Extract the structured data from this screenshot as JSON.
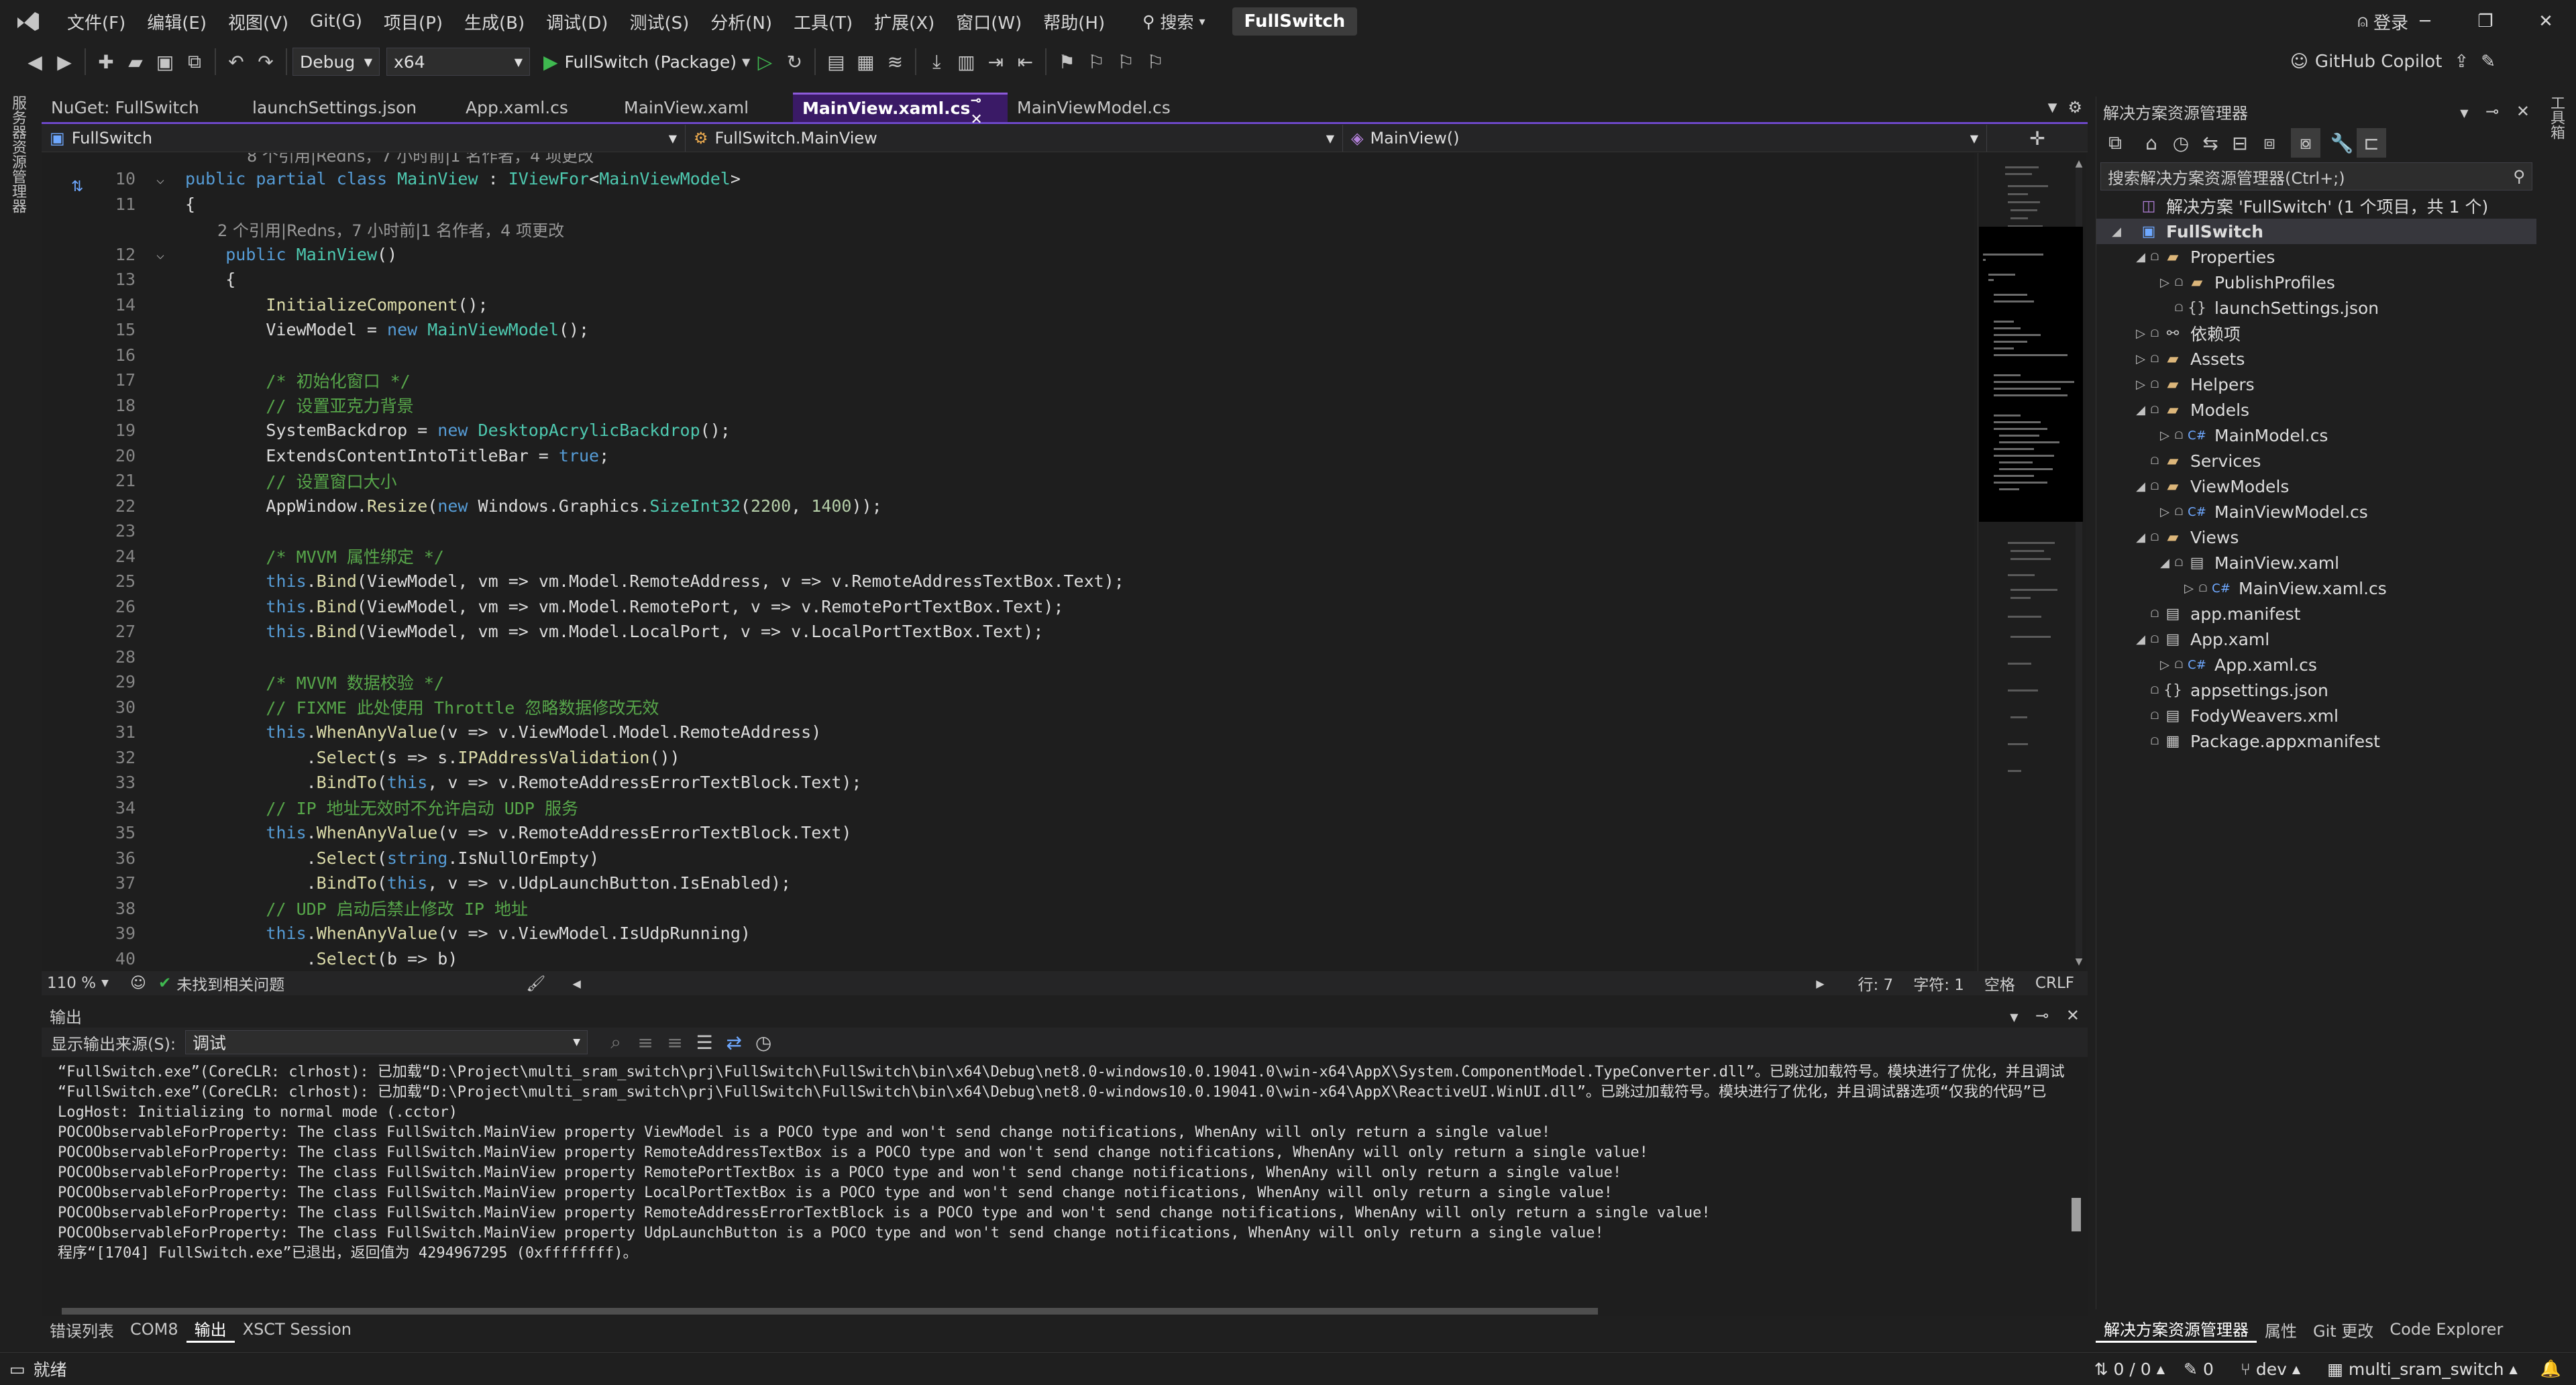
{
  "menubar": {
    "items": [
      "文件(F)",
      "编辑(E)",
      "视图(V)",
      "Git(G)",
      "项目(P)",
      "生成(B)",
      "调试(D)",
      "测试(S)",
      "分析(N)",
      "工具(T)",
      "扩展(X)",
      "窗口(W)",
      "帮助(H)"
    ],
    "search_label": "搜索",
    "solution_name": "FullSwitch",
    "login_label": "登录"
  },
  "toolbar": {
    "config": "Debug",
    "platform": "x64",
    "run_target": "FullSwitch (Package)",
    "copilot_label": "GitHub Copilot"
  },
  "left_strip": {
    "label": "服务器资源管理器"
  },
  "right_strip": {
    "label": "工具箱"
  },
  "tabs": [
    {
      "label": "NuGet: FullSwitch"
    },
    {
      "label": "launchSettings.json"
    },
    {
      "label": "App.xaml.cs"
    },
    {
      "label": "MainView.xaml"
    },
    {
      "label": "MainView.xaml.cs"
    },
    {
      "label": "MainViewModel.cs"
    }
  ],
  "navbar": {
    "project": "FullSwitch",
    "class": "FullSwitch.MainView",
    "member": "MainView()"
  },
  "codelens": {
    "class_refs": "8 个引用|Redns，7 小时前|1 名作者，4 项更改",
    "ctor_refs": "2 个引用|Redns，7 小时前|1 名作者，4 项更改"
  },
  "code": {
    "lines": [
      {
        "n": "10",
        "t": "public partial class MainView : IViewFor<MainViewModel>"
      },
      {
        "n": "11",
        "t": "{"
      },
      {
        "n": "12",
        "t": "    public MainView()"
      },
      {
        "n": "13",
        "t": "    {"
      },
      {
        "n": "14",
        "t": "        InitializeComponent();"
      },
      {
        "n": "15",
        "t": "        ViewModel = new MainViewModel();"
      },
      {
        "n": "16",
        "t": ""
      },
      {
        "n": "17",
        "t": "        /* 初始化窗口 */"
      },
      {
        "n": "18",
        "t": "        // 设置亚克力背景"
      },
      {
        "n": "19",
        "t": "        SystemBackdrop = new DesktopAcrylicBackdrop();"
      },
      {
        "n": "20",
        "t": "        ExtendsContentIntoTitleBar = true;"
      },
      {
        "n": "21",
        "t": "        // 设置窗口大小"
      },
      {
        "n": "22",
        "t": "        AppWindow.Resize(new Windows.Graphics.SizeInt32(2200, 1400));"
      },
      {
        "n": "23",
        "t": ""
      },
      {
        "n": "24",
        "t": "        /* MVVM 属性绑定 */"
      },
      {
        "n": "25",
        "t": "        this.Bind(ViewModel, vm => vm.Model.RemoteAddress, v => v.RemoteAddressTextBox.Text);"
      },
      {
        "n": "26",
        "t": "        this.Bind(ViewModel, vm => vm.Model.RemotePort, v => v.RemotePortTextBox.Text);"
      },
      {
        "n": "27",
        "t": "        this.Bind(ViewModel, vm => vm.Model.LocalPort, v => v.LocalPortTextBox.Text);"
      },
      {
        "n": "28",
        "t": ""
      },
      {
        "n": "29",
        "t": "        /* MVVM 数据校验 */"
      },
      {
        "n": "30",
        "t": "        // FIXME 此处使用 Throttle 忽略数据修改无效"
      },
      {
        "n": "31",
        "t": "        this.WhenAnyValue(v => v.ViewModel.Model.RemoteAddress)"
      },
      {
        "n": "32",
        "t": "            .Select(s => s.IPAddressValidation())"
      },
      {
        "n": "33",
        "t": "            .BindTo(this, v => v.RemoteAddressErrorTextBlock.Text);"
      },
      {
        "n": "34",
        "t": "        // IP 地址无效时不允许启动 UDP 服务"
      },
      {
        "n": "35",
        "t": "        this.WhenAnyValue(v => v.RemoteAddressErrorTextBlock.Text)"
      },
      {
        "n": "36",
        "t": "            .Select(string.IsNullOrEmpty)"
      },
      {
        "n": "37",
        "t": "            .BindTo(this, v => v.UdpLaunchButton.IsEnabled);"
      },
      {
        "n": "38",
        "t": "        // UDP 启动后禁止修改 IP 地址"
      },
      {
        "n": "39",
        "t": "        this.WhenAnyValue(v => v.ViewModel.IsUdpRunning)"
      },
      {
        "n": "40",
        "t": "            .Select(b => b)"
      }
    ]
  },
  "editor_status": {
    "zoom": "110 %",
    "issues": "未找到相关问题",
    "line": "行: 7",
    "char": "字符: 1",
    "whitespace": "空格",
    "eol": "CRLF"
  },
  "output": {
    "title": "输出",
    "source_label": "显示输出来源(S):",
    "source_value": "调试",
    "lines": [
      "“FullSwitch.exe”(CoreCLR: clrhost): 已加载“D:\\Project\\multi_sram_switch\\prj\\FullSwitch\\FullSwitch\\bin\\x64\\Debug\\net8.0-windows10.0.19041.0\\win-x64\\AppX\\System.ComponentModel.TypeConverter.dll”。已跳过加载符号。模块进行了优化，并且调试",
      "“FullSwitch.exe”(CoreCLR: clrhost): 已加载“D:\\Project\\multi_sram_switch\\prj\\FullSwitch\\FullSwitch\\bin\\x64\\Debug\\net8.0-windows10.0.19041.0\\win-x64\\AppX\\ReactiveUI.WinUI.dll”。已跳过加载符号。模块进行了优化，并且调试器选项“仅我的代码”已",
      "LogHost: Initializing to normal mode (.cctor)",
      "POCOObservableForProperty: The class FullSwitch.MainView property ViewModel is a POCO type and won't send change notifications, WhenAny will only return a single value!",
      "POCOObservableForProperty: The class FullSwitch.MainView property RemoteAddressTextBox is a POCO type and won't send change notifications, WhenAny will only return a single value!",
      "POCOObservableForProperty: The class FullSwitch.MainView property RemotePortTextBox is a POCO type and won't send change notifications, WhenAny will only return a single value!",
      "POCOObservableForProperty: The class FullSwitch.MainView property LocalPortTextBox is a POCO type and won't send change notifications, WhenAny will only return a single value!",
      "POCOObservableForProperty: The class FullSwitch.MainView property RemoteAddressErrorTextBlock is a POCO type and won't send change notifications, WhenAny will only return a single value!",
      "POCOObservableForProperty: The class FullSwitch.MainView property UdpLaunchButton is a POCO type and won't send change notifications, WhenAny will only return a single value!",
      "程序“[1704] FullSwitch.exe”已退出，返回值为 4294967295 (0xffffffff)。"
    ]
  },
  "bottom_tabs": [
    "错误列表",
    "COM8",
    "输出",
    "XSCT Session"
  ],
  "solution_explorer": {
    "title": "解决方案资源管理器",
    "search_placeholder": "搜索解决方案资源管理器(Ctrl+;)",
    "tree": [
      {
        "label": "解决方案 'FullSwitch' (1 个项目，共 1 个)",
        "depth": 0,
        "arrow": "",
        "icon": "solution-icon"
      },
      {
        "label": "FullSwitch",
        "depth": 0,
        "arrow": "◢",
        "icon": "project-icon",
        "bold": true,
        "selected": true
      },
      {
        "label": "Properties",
        "depth": 1,
        "arrow": "◢",
        "icon": "properties-folder-icon"
      },
      {
        "label": "PublishProfiles",
        "depth": 2,
        "arrow": "▷",
        "icon": "folder-icon"
      },
      {
        "label": "launchSettings.json",
        "depth": 2,
        "arrow": "",
        "icon": "json-file-icon"
      },
      {
        "label": "依赖项",
        "depth": 1,
        "arrow": "▷",
        "icon": "dependencies-icon"
      },
      {
        "label": "Assets",
        "depth": 1,
        "arrow": "▷",
        "icon": "folder-icon"
      },
      {
        "label": "Helpers",
        "depth": 1,
        "arrow": "▷",
        "icon": "folder-icon"
      },
      {
        "label": "Models",
        "depth": 1,
        "arrow": "◢",
        "icon": "folder-icon"
      },
      {
        "label": "MainModel.cs",
        "depth": 2,
        "arrow": "▷",
        "icon": "csharp-file-icon"
      },
      {
        "label": "Services",
        "depth": 1,
        "arrow": "",
        "icon": "folder-icon"
      },
      {
        "label": "ViewModels",
        "depth": 1,
        "arrow": "◢",
        "icon": "folder-icon"
      },
      {
        "label": "MainViewModel.cs",
        "depth": 2,
        "arrow": "▷",
        "icon": "csharp-file-icon"
      },
      {
        "label": "Views",
        "depth": 1,
        "arrow": "◢",
        "icon": "folder-icon"
      },
      {
        "label": "MainView.xaml",
        "depth": 2,
        "arrow": "◢",
        "icon": "xaml-file-icon"
      },
      {
        "label": "MainView.xaml.cs",
        "depth": 3,
        "arrow": "▷",
        "icon": "csharp-file-icon"
      },
      {
        "label": "app.manifest",
        "depth": 1,
        "arrow": "",
        "icon": "manifest-file-icon"
      },
      {
        "label": "App.xaml",
        "depth": 1,
        "arrow": "◢",
        "icon": "xaml-file-icon"
      },
      {
        "label": "App.xaml.cs",
        "depth": 2,
        "arrow": "▷",
        "icon": "csharp-file-icon"
      },
      {
        "label": "appsettings.json",
        "depth": 1,
        "arrow": "",
        "icon": "json-file-icon"
      },
      {
        "label": "FodyWeavers.xml",
        "depth": 1,
        "arrow": "",
        "icon": "xml-file-icon"
      },
      {
        "label": "Package.appxmanifest",
        "depth": 1,
        "arrow": "",
        "icon": "appx-manifest-icon"
      }
    ],
    "tabs": [
      "解决方案资源管理器",
      "属性",
      "Git 更改",
      "Code Explorer"
    ]
  },
  "statusbar": {
    "ready": "就绪",
    "changes": "0 / 0",
    "pending": "0",
    "branch": "dev",
    "repo": "multi_sram_switch"
  },
  "colors": {
    "accent": "#6e48c9",
    "active_tab": "#3a1a66",
    "keyword": "#569cd6",
    "type": "#4ec9b0",
    "comment": "#57a64a",
    "method": "#dcdcaa",
    "number": "#b5cea8"
  }
}
